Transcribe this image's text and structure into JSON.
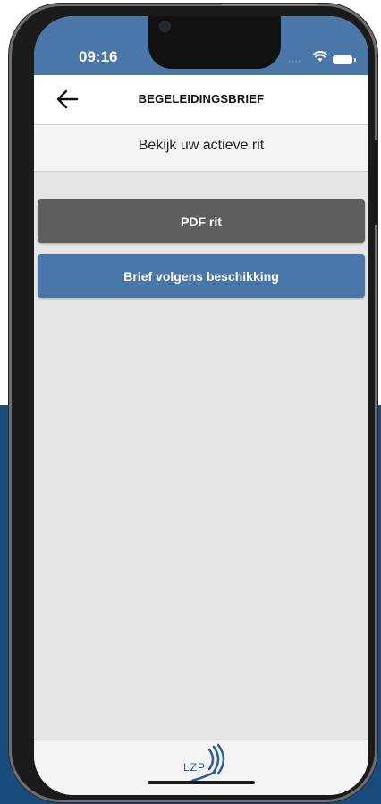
{
  "status_bar": {
    "time": "09:16",
    "signal": "....",
    "wifi_icon": "wifi-icon",
    "battery_icon": "battery-icon"
  },
  "navbar": {
    "back_icon": "arrow-left-icon",
    "title": "BEGELEIDINGSBRIEF"
  },
  "subheader": {
    "text": "Bekijk uw actieve rit"
  },
  "actions": {
    "pdf_label": "PDF rit",
    "brief_label": "Brief volgens beschikking"
  },
  "footer": {
    "logo_text": "LZP"
  },
  "colors": {
    "primary": "#4a76a8",
    "pdf_button": "#5e5e5e",
    "screen_background": "#e6e6e6",
    "page_background_blue": "#1a4b7d"
  }
}
